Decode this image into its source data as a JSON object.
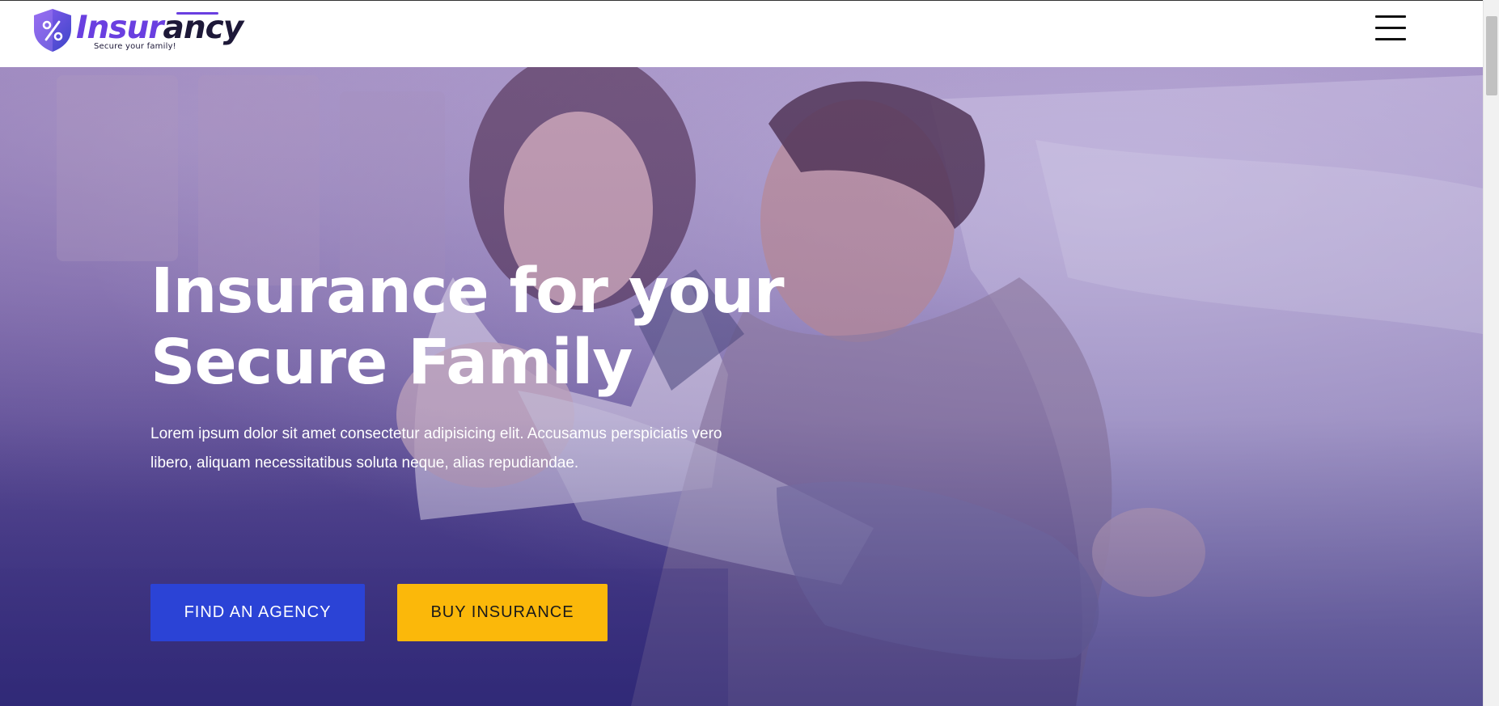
{
  "header": {
    "logo": {
      "word_part1": "Insur",
      "word_part2": "ancy",
      "tagline": "Secure your family!",
      "icon": "shield-percent-icon"
    },
    "menu_icon": "hamburger-menu-icon"
  },
  "hero": {
    "title_line1": "Insurance for your",
    "title_line2": "Secure Family",
    "description": "Lorem ipsum dolor sit amet consectetur adipisicing elit. Accusamus perspiciatis vero libero, aliquam necessitatibus soluta neque, alias repudiandae.",
    "primary_button": "FIND AN AGENCY",
    "secondary_button": "BUY INSURANCE",
    "background": "family-photo"
  },
  "colors": {
    "brand_purple": "#6a3fe0",
    "brand_dark": "#1d1838",
    "button_blue": "#2b43d6",
    "button_yellow": "#fbb80a",
    "hero_tint": "#5b4d92"
  }
}
